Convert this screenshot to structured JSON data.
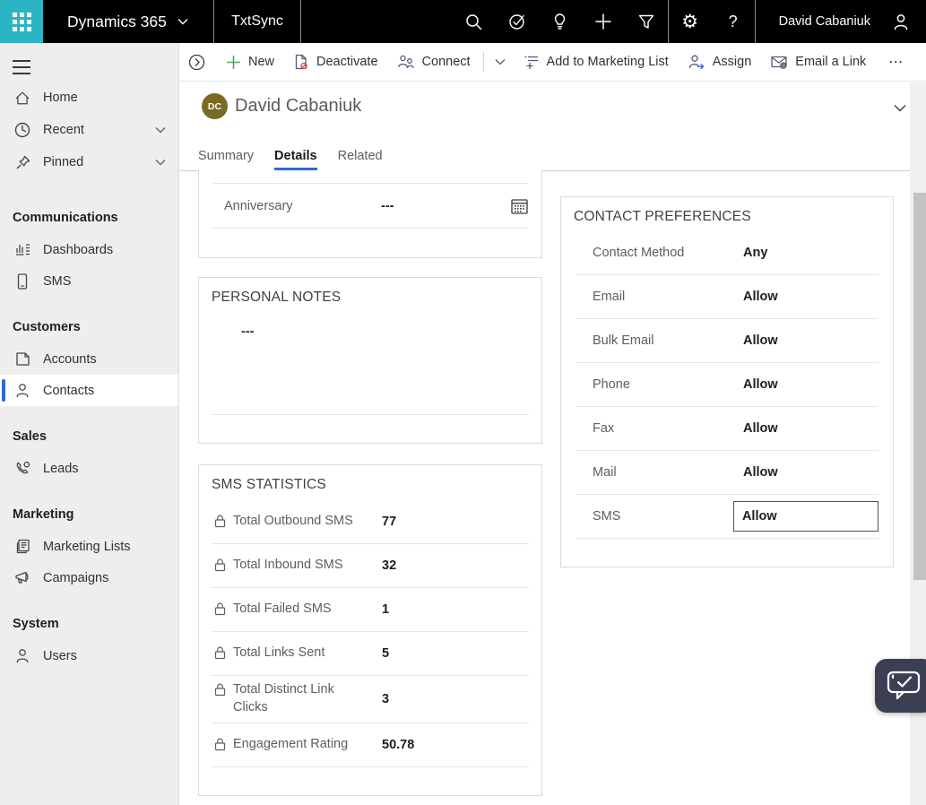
{
  "colors": {
    "accent_teal": "#2bb4c4",
    "accent_blue": "#2b6bd8",
    "avatar_olive": "#7b6a26",
    "new_green": "#4ea558",
    "deactivate_red": "#cf4747",
    "chat_widget_bg": "#3a3f53"
  },
  "topbar": {
    "brand": "Dynamics 365",
    "app_name": "TxtSync",
    "user_name": "David Cabaniuk",
    "gear_glyph": "⚙",
    "help_glyph": "?"
  },
  "command_bar": {
    "overflow_glyph": "⋯",
    "items": [
      {
        "label": "New"
      },
      {
        "label": "Deactivate"
      },
      {
        "label": "Connect"
      },
      {
        "label": "Add to Marketing List"
      },
      {
        "label": "Assign"
      },
      {
        "label": "Email a Link"
      }
    ]
  },
  "sidebar": {
    "top_items": [
      {
        "label": "Home"
      },
      {
        "label": "Recent"
      },
      {
        "label": "Pinned"
      }
    ],
    "groups": [
      {
        "title": "Communications",
        "items": [
          {
            "label": "Dashboards"
          },
          {
            "label": "SMS"
          }
        ]
      },
      {
        "title": "Customers",
        "items": [
          {
            "label": "Accounts"
          },
          {
            "label": "Contacts",
            "selected": true
          }
        ]
      },
      {
        "title": "Sales",
        "items": [
          {
            "label": "Leads"
          }
        ]
      },
      {
        "title": "Marketing",
        "items": [
          {
            "label": "Marketing Lists"
          },
          {
            "label": "Campaigns"
          }
        ]
      },
      {
        "title": "System",
        "items": [
          {
            "label": "Users"
          }
        ]
      }
    ]
  },
  "record": {
    "initials": "DC",
    "name": "David Cabaniuk",
    "tabs": [
      {
        "label": "Summary"
      },
      {
        "label": "Details",
        "active": true
      },
      {
        "label": "Related"
      }
    ]
  },
  "form": {
    "anniversary": {
      "label": "Anniversary",
      "value": "---"
    },
    "personal_notes": {
      "title": "PERSONAL NOTES",
      "value": "---"
    },
    "sms_statistics": {
      "title": "SMS STATISTICS",
      "rows": [
        {
          "label": "Total Outbound SMS",
          "value": "77"
        },
        {
          "label": "Total Inbound SMS",
          "value": "32"
        },
        {
          "label": "Total Failed SMS",
          "value": "1"
        },
        {
          "label": "Total Links Sent",
          "value": "5"
        },
        {
          "label": "Total Distinct Link Clicks",
          "value": "3"
        },
        {
          "label": "Engagement Rating",
          "value": "50.78"
        }
      ]
    },
    "contact_preferences": {
      "title": "CONTACT PREFERENCES",
      "rows": [
        {
          "label": "Contact Method",
          "value": "Any"
        },
        {
          "label": "Email",
          "value": "Allow"
        },
        {
          "label": "Bulk Email",
          "value": "Allow"
        },
        {
          "label": "Phone",
          "value": "Allow"
        },
        {
          "label": "Fax",
          "value": "Allow"
        },
        {
          "label": "Mail",
          "value": "Allow"
        },
        {
          "label": "SMS",
          "value": "Allow",
          "focused": true
        }
      ]
    }
  }
}
